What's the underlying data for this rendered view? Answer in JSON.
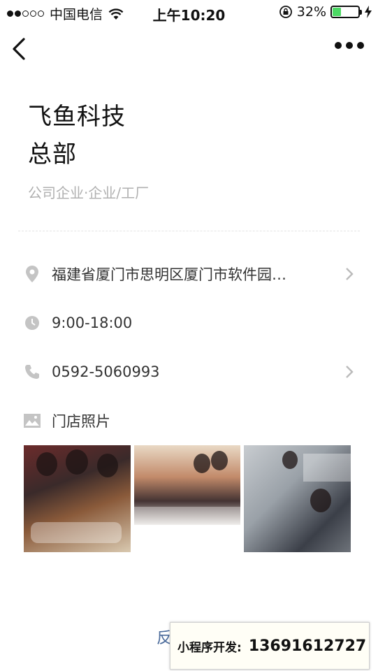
{
  "status_bar": {
    "carrier": "中国电信",
    "time": "上午10:20",
    "battery_percent": "32%",
    "battery_level": 0.32,
    "signal_bars": 2
  },
  "nav": {
    "back_icon": "chevron-left-icon",
    "more_icon": "more-dots-icon"
  },
  "header": {
    "title_line1": "飞鱼科技",
    "title_line2": "总部",
    "category": "公司企业·企业/工厂"
  },
  "info": {
    "address": "福建省厦门市思明区厦门市软件园…",
    "hours": "9:00-18:00",
    "phone": "0592-5060993",
    "photos_label": "门店照片"
  },
  "footer": {
    "feedback_prefix": "反",
    "banner_label": "小程序开发:",
    "banner_phone": "13691612727"
  },
  "colors": {
    "icon_gray": "#c4c4c4",
    "battery_green": "#4cd964",
    "category_gray": "#b0b0b0",
    "link_blue": "#4a6a9a"
  }
}
